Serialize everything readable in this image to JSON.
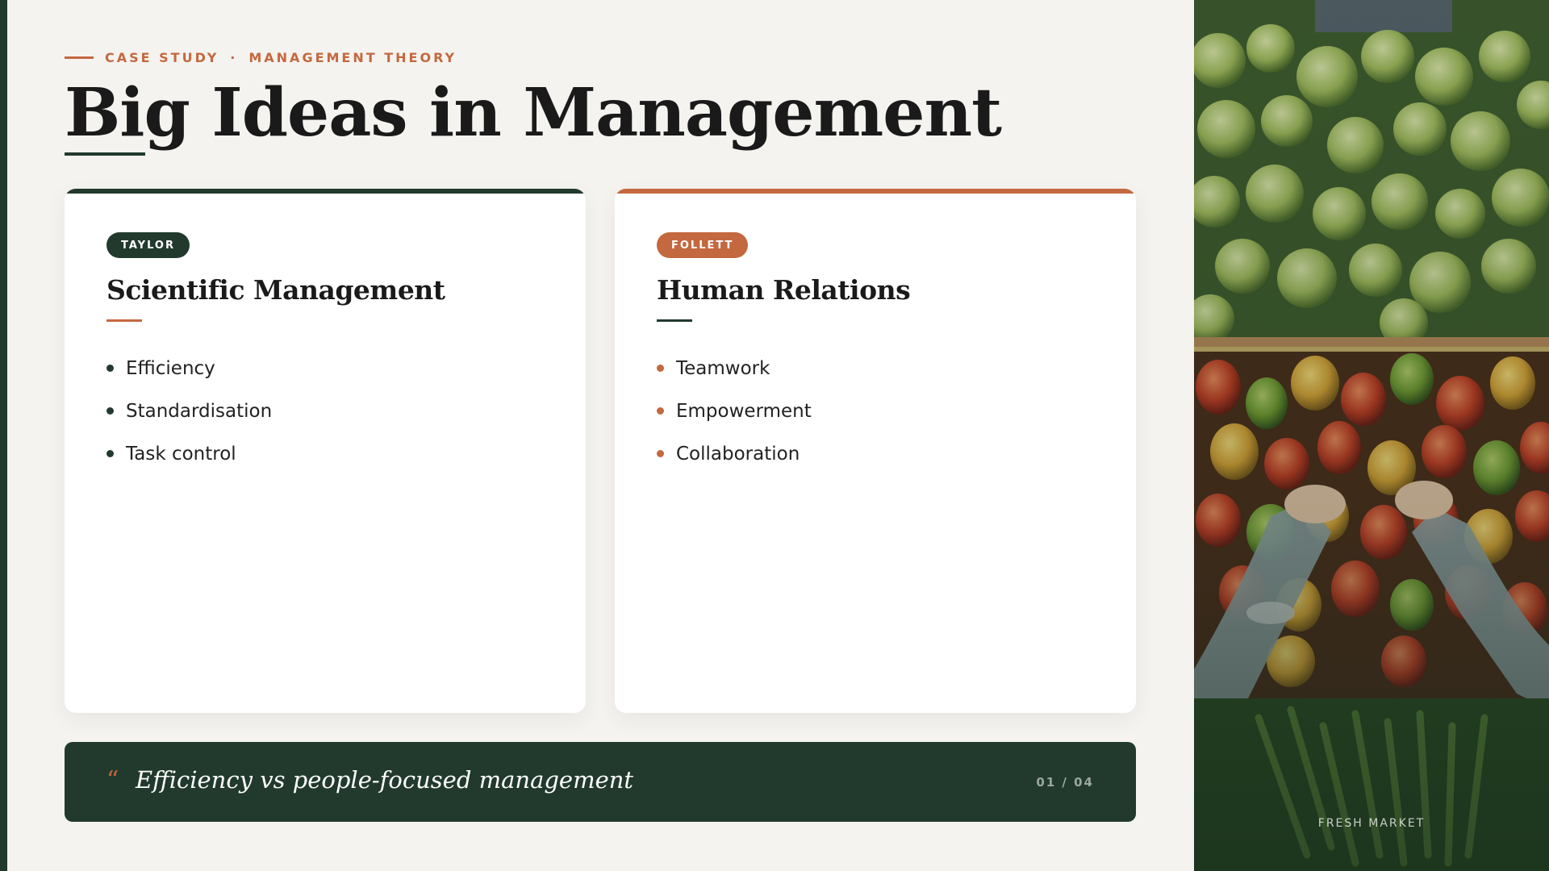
{
  "eyebrow": {
    "left": "CASE STUDY",
    "separator": "·",
    "right": "MANAGEMENT THEORY"
  },
  "title": "Big Ideas in Management",
  "cards": [
    {
      "badge": "TAYLOR",
      "title": "Scientific Management",
      "accent": "#223a2e",
      "items": [
        "Efficiency",
        "Standardisation",
        "Task control"
      ]
    },
    {
      "badge": "FOLLETT",
      "title": "Human Relations",
      "accent": "#c4683f",
      "items": [
        "Teamwork",
        "Empowerment",
        "Collaboration"
      ]
    }
  ],
  "quote": {
    "mark": "“",
    "text": "Efficiency vs people-focused management",
    "page": "01 / 04"
  },
  "photo": {
    "caption": "FRESH MARKET",
    "subject": "market-produce-photo"
  },
  "colors": {
    "primary": "#223a2e",
    "accent": "#c4683f",
    "background": "#f5f3ef"
  }
}
